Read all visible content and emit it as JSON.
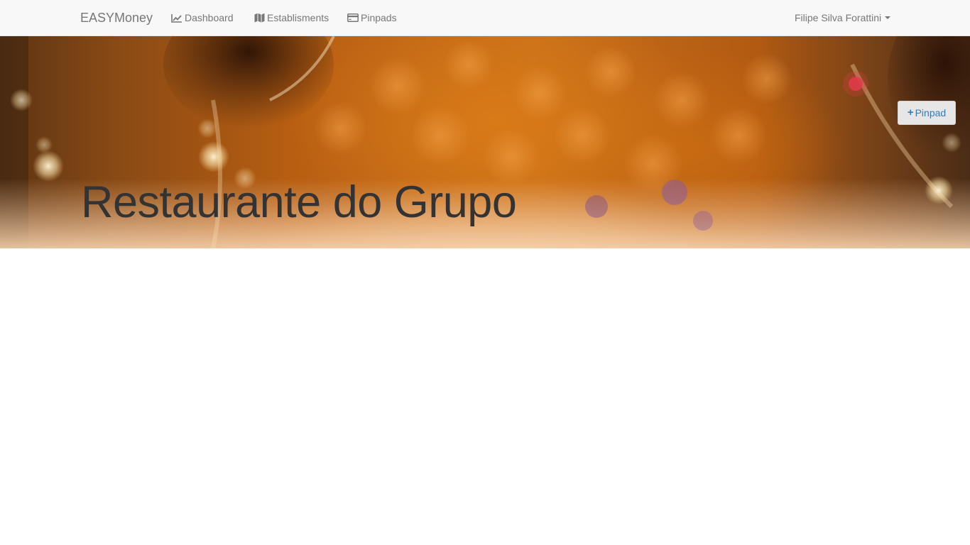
{
  "navbar": {
    "brand": "EASYMoney",
    "links": [
      {
        "label": "Dashboard",
        "icon": "line-chart-icon"
      },
      {
        "label": "Establisments",
        "icon": "map-icon"
      },
      {
        "label": "Pinpads",
        "icon": "credit-card-icon"
      }
    ],
    "user": {
      "name": "Filipe Silva Forattini",
      "icon": "caret-down-icon"
    }
  },
  "hero": {
    "title": "Restaurante do Grupo",
    "add_button": {
      "label": "Pinpad",
      "icon": "plus-icon"
    }
  },
  "colors": {
    "navbar_bg": "#f8f8f8",
    "nav_text": "#777777",
    "title_text": "#333333",
    "button_text": "#337ab7",
    "button_bg": "#e6e6e6"
  }
}
